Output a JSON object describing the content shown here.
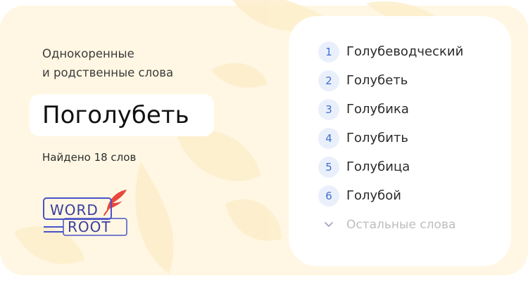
{
  "heading": {
    "line1": "Однокоренные",
    "line2": "и родственные слова"
  },
  "word": "Поголубеть",
  "found_text": "Найдено 18 слов",
  "logo": {
    "line1": "WORD",
    "line2": "ROOT",
    "feather_color": "#e8473c",
    "accent_color": "#4a52c8",
    "icon": "feather-icon"
  },
  "related_words": [
    {
      "num": "1",
      "word": "Голубеводческий"
    },
    {
      "num": "2",
      "word": "Голубеть"
    },
    {
      "num": "3",
      "word": "Голубика"
    },
    {
      "num": "4",
      "word": "Голубить"
    },
    {
      "num": "5",
      "word": "Голубица"
    },
    {
      "num": "6",
      "word": "Голубой"
    }
  ],
  "more": {
    "label": "Остальные слова",
    "icon": "chevron-down-icon"
  },
  "colors": {
    "background": "#fff7e3",
    "number_badge_bg": "#eaf0fb",
    "number_text": "#3f6fd1",
    "muted_text": "#bdbdbd"
  }
}
